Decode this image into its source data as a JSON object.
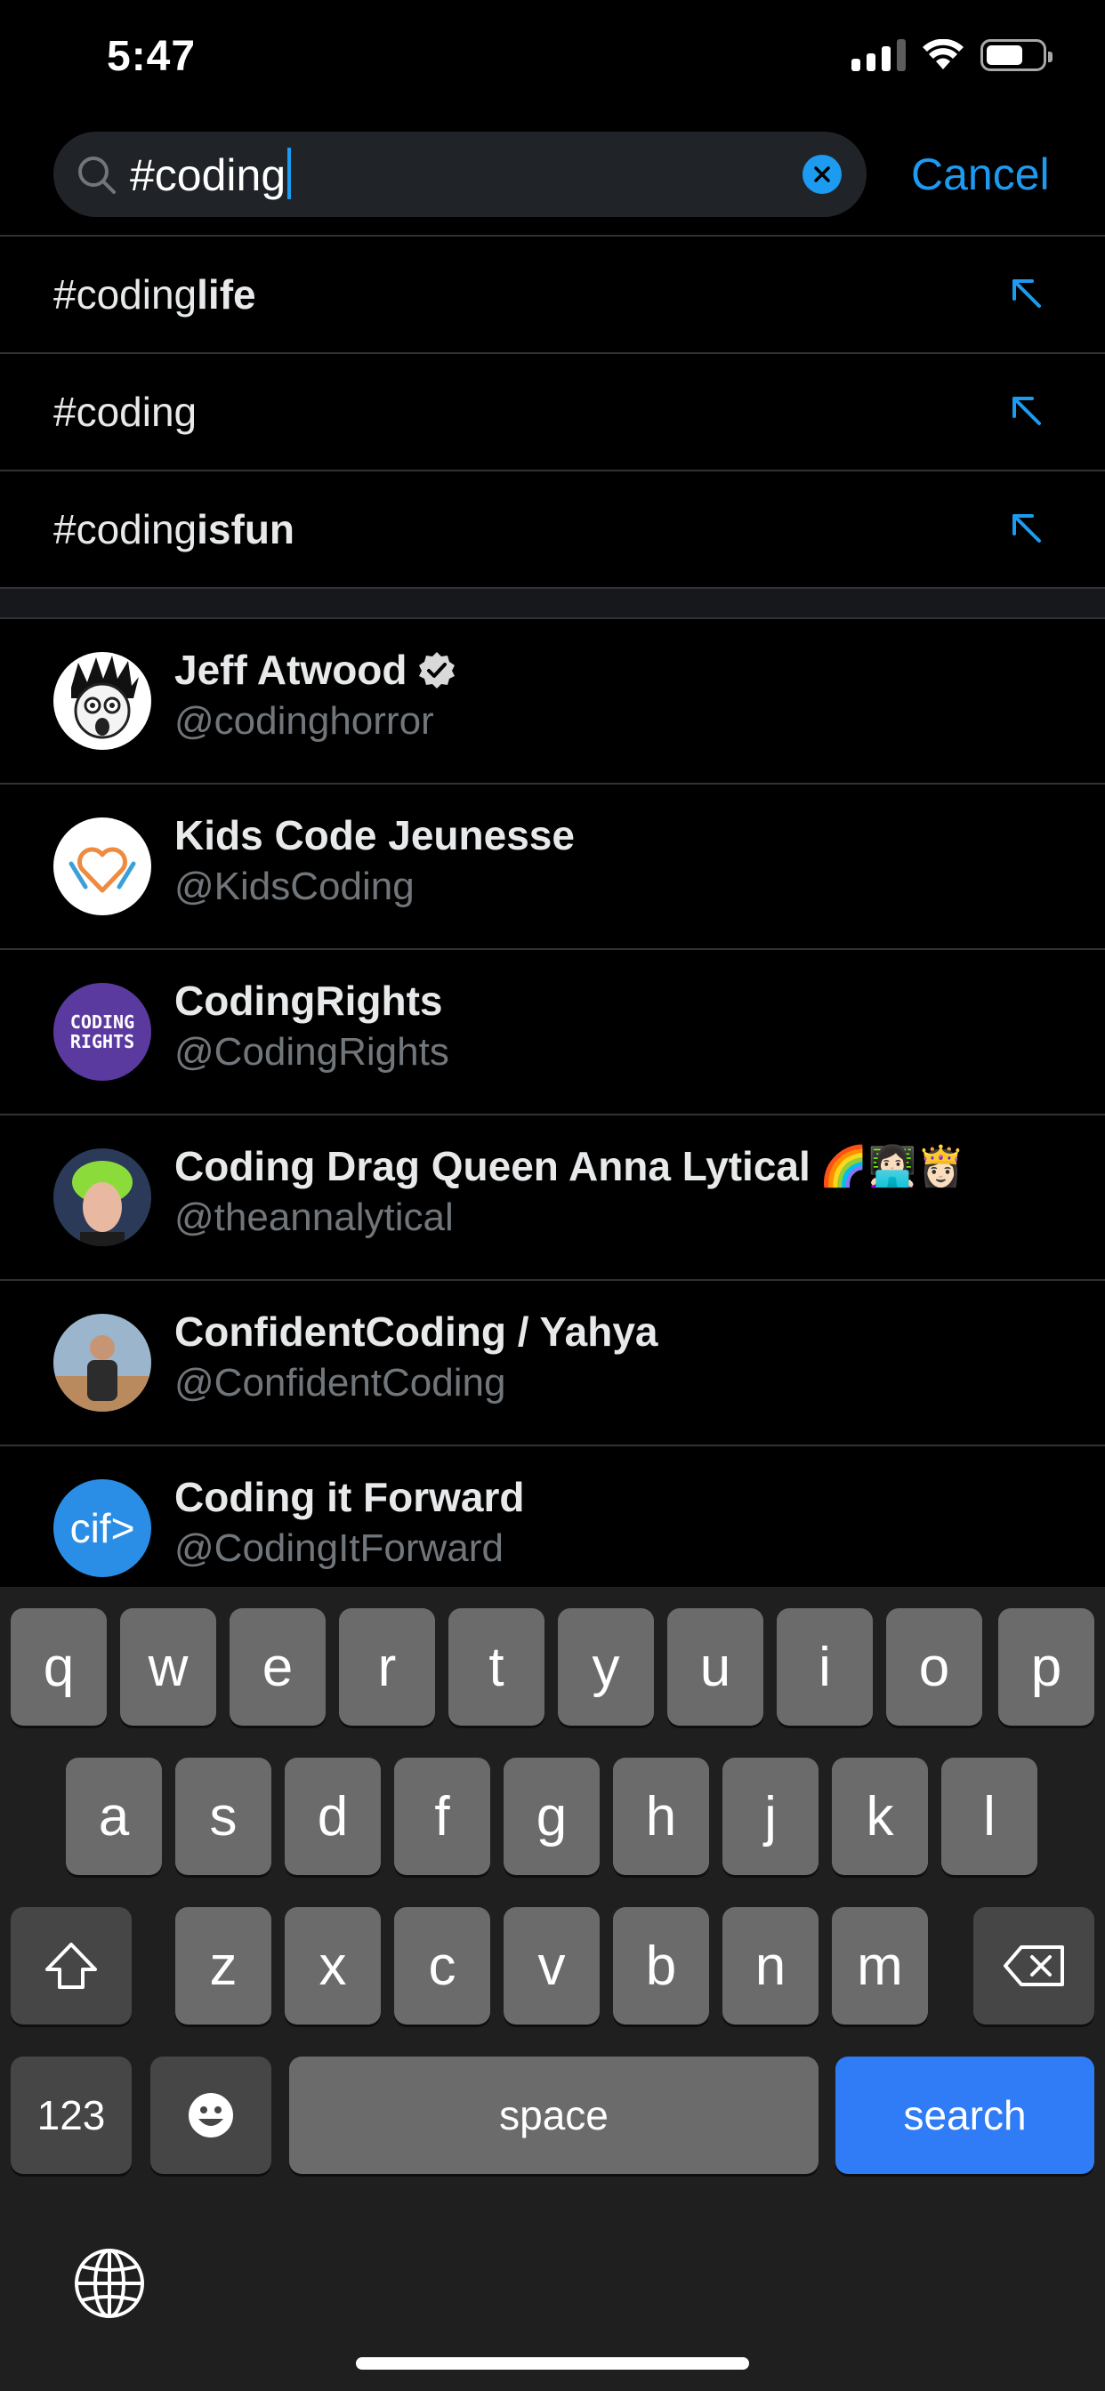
{
  "status_bar": {
    "time": "5:47"
  },
  "search": {
    "value": "#coding",
    "cancel_label": "Cancel",
    "icon": "search-icon",
    "clear_icon": "clear-x-icon"
  },
  "suggestions": [
    {
      "prefix": "#coding",
      "suffix": "life"
    },
    {
      "prefix": "#coding",
      "suffix": ""
    },
    {
      "prefix": "#coding",
      "suffix": "isfun"
    }
  ],
  "users": [
    {
      "name": "Jeff Atwood",
      "handle": "@codinghorror",
      "verified": true,
      "emoji": ""
    },
    {
      "name": "Kids Code Jeunesse",
      "handle": "@KidsCoding",
      "verified": false,
      "emoji": ""
    },
    {
      "name": "CodingRights",
      "handle": "@CodingRights",
      "verified": false,
      "emoji": "",
      "avatar_text_1": "CODING",
      "avatar_text_2": "RIGHTS"
    },
    {
      "name": "Coding Drag Queen Anna Lytical",
      "handle": "@theannalytical",
      "verified": false,
      "emoji": "🌈👩🏻‍💻👸🏻"
    },
    {
      "name": "ConfidentCoding / Yahya",
      "handle": "@ConfidentCoding",
      "verified": false,
      "emoji": ""
    },
    {
      "name": "Coding it Forward",
      "handle": "@CodingItForward",
      "verified": false,
      "emoji": "",
      "avatar_text_1": "cif>"
    }
  ],
  "keyboard": {
    "row1": [
      "q",
      "w",
      "e",
      "r",
      "t",
      "y",
      "u",
      "i",
      "o",
      "p"
    ],
    "row2": [
      "a",
      "s",
      "d",
      "f",
      "g",
      "h",
      "j",
      "k",
      "l"
    ],
    "row3": [
      "z",
      "x",
      "c",
      "v",
      "b",
      "n",
      "m"
    ],
    "numbers_label": "123",
    "space_label": "space",
    "search_label": "search"
  },
  "colors": {
    "accent": "#1d9bf0",
    "keyboard_search": "#2f7cf6",
    "secondary_text": "#71767b"
  }
}
